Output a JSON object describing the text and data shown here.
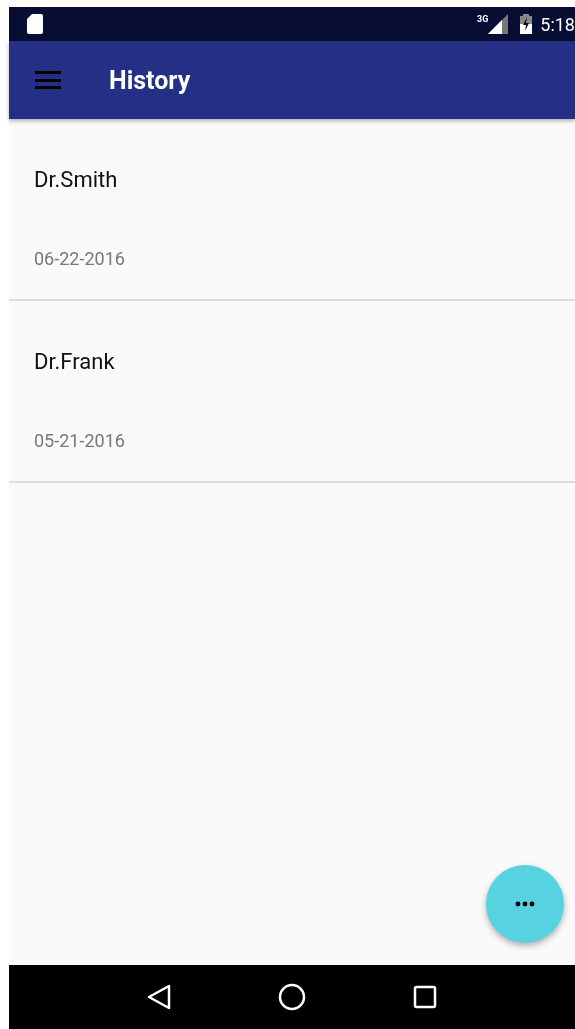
{
  "status_bar": {
    "network": "3G",
    "time": "5:18"
  },
  "app_bar": {
    "title": "History"
  },
  "history": [
    {
      "name": "Dr.Smith",
      "date": "06-22-2016"
    },
    {
      "name": "Dr.Frank",
      "date": "05-21-2016"
    }
  ]
}
